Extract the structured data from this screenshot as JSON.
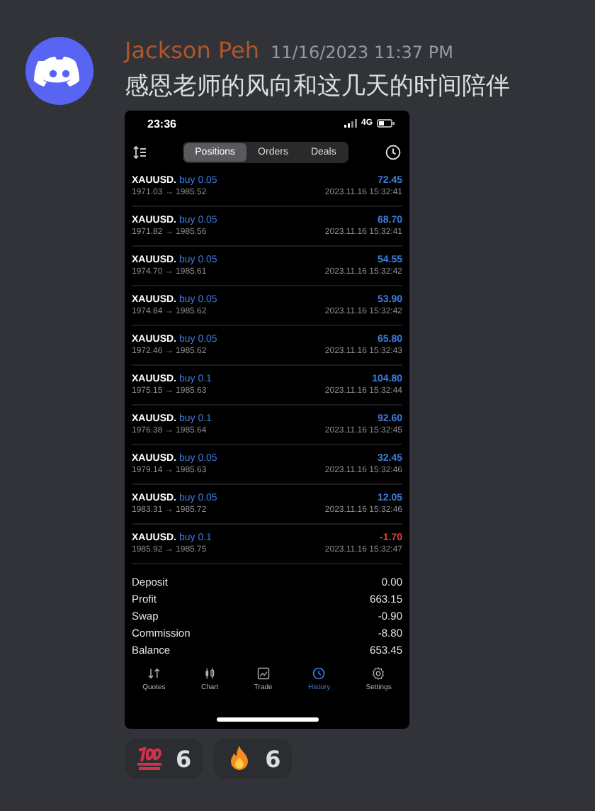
{
  "message": {
    "author": "Jackson Peh",
    "timestamp": "11/16/2023 11:37 PM",
    "text": "感恩老师的风向和这几天的时间陪伴"
  },
  "screenshot": {
    "status_time": "23:36",
    "network": "4G",
    "tabs": [
      {
        "label": "Positions",
        "selected": true
      },
      {
        "label": "Orders",
        "selected": false
      },
      {
        "label": "Deals",
        "selected": false
      }
    ],
    "trades": [
      {
        "symbol": "XAUUSD.",
        "order": "buy 0.05",
        "prices": "1971.03 → 1985.52",
        "profit": "72.45",
        "color": "#3b7ddd",
        "time": "2023.11.16 15:32:41"
      },
      {
        "symbol": "XAUUSD.",
        "order": "buy 0.05",
        "prices": "1971.82 → 1985.56",
        "profit": "68.70",
        "color": "#3b7ddd",
        "time": "2023.11.16 15:32:41"
      },
      {
        "symbol": "XAUUSD.",
        "order": "buy 0.05",
        "prices": "1974.70 → 1985.61",
        "profit": "54.55",
        "color": "#3b7ddd",
        "time": "2023.11.16 15:32:42"
      },
      {
        "symbol": "XAUUSD.",
        "order": "buy 0.05",
        "prices": "1974.84 → 1985.62",
        "profit": "53.90",
        "color": "#3b7ddd",
        "time": "2023.11.16 15:32:42"
      },
      {
        "symbol": "XAUUSD.",
        "order": "buy 0.05",
        "prices": "1972.46 → 1985.62",
        "profit": "65.80",
        "color": "#3b7ddd",
        "time": "2023.11.16 15:32:43"
      },
      {
        "symbol": "XAUUSD.",
        "order": "buy 0.1",
        "prices": "1975.15 → 1985.63",
        "profit": "104.80",
        "color": "#3b7ddd",
        "time": "2023.11.16 15:32:44"
      },
      {
        "symbol": "XAUUSD.",
        "order": "buy 0.1",
        "prices": "1976.38 → 1985.64",
        "profit": "92.60",
        "color": "#3b7ddd",
        "time": "2023.11.16 15:32:45"
      },
      {
        "symbol": "XAUUSD.",
        "order": "buy 0.05",
        "prices": "1979.14 → 1985.63",
        "profit": "32.45",
        "color": "#3b7ddd",
        "time": "2023.11.16 15:32:46"
      },
      {
        "symbol": "XAUUSD.",
        "order": "buy 0.05",
        "prices": "1983.31 → 1985.72",
        "profit": "12.05",
        "color": "#3b7ddd",
        "time": "2023.11.16 15:32:46"
      },
      {
        "symbol": "XAUUSD.",
        "order": "buy 0.1",
        "prices": "1985.92 → 1985.75",
        "profit": "-1.70",
        "color": "#d9443a",
        "time": "2023.11.16 15:32:47"
      }
    ],
    "summary": [
      {
        "label": "Deposit",
        "value": "0.00"
      },
      {
        "label": "Profit",
        "value": "663.15"
      },
      {
        "label": "Swap",
        "value": "-0.90"
      },
      {
        "label": "Commission",
        "value": "-8.80"
      },
      {
        "label": "Balance",
        "value": "653.45"
      }
    ],
    "nav": [
      {
        "label": "Quotes",
        "selected": false
      },
      {
        "label": "Chart",
        "selected": false
      },
      {
        "label": "Trade",
        "selected": false
      },
      {
        "label": "History",
        "selected": true
      },
      {
        "label": "Settings",
        "selected": false
      }
    ]
  },
  "reactions": [
    {
      "count": "6"
    },
    {
      "count": "6"
    }
  ]
}
